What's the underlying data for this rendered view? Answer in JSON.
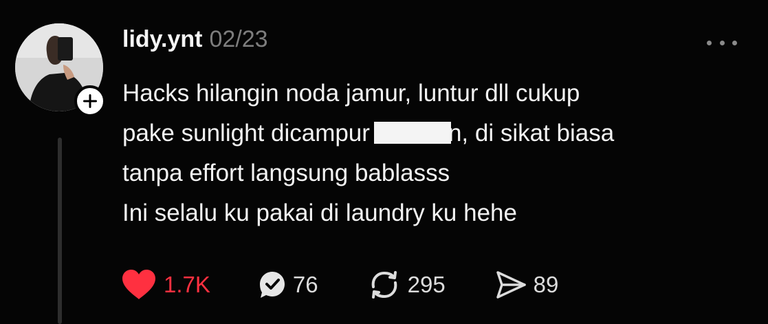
{
  "post": {
    "username": "lidy.ynt",
    "timestamp": "02/23",
    "body_lines": [
      "Hacks hilangin noda jamur, luntur dll cukup",
      "pake sunlight dicampur",
      "n, di sikat biasa",
      "tanpa effort langsung bablasss",
      "Ini selalu ku pakai di laundry ku hehe"
    ]
  },
  "actions": {
    "likes": "1.7K",
    "replies": "76",
    "reposts": "295",
    "shares": "89"
  },
  "icons": {
    "like": "heart-icon",
    "reply": "speech-bubble-check-icon",
    "repost": "repost-arrows-icon",
    "share": "send-icon",
    "more": "more-options-icon",
    "follow": "plus-icon"
  },
  "colors": {
    "background": "#050505",
    "like_accent": "#ff3040",
    "muted": "#7d7d7d"
  }
}
